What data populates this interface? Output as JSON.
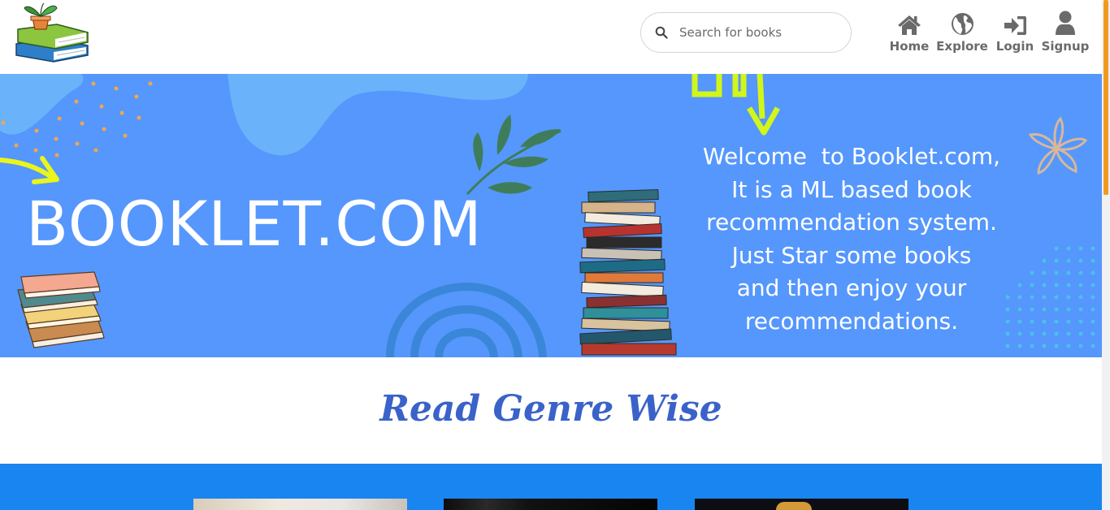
{
  "header": {
    "search": {
      "placeholder": "Search for books"
    },
    "nav": [
      {
        "label": "Home",
        "icon": "home-icon"
      },
      {
        "label": "Explore",
        "icon": "globe-icon"
      },
      {
        "label": "Login",
        "icon": "sign-in-icon"
      },
      {
        "label": "Signup",
        "icon": "user-icon"
      }
    ]
  },
  "banner": {
    "brand": "BOOKLET.COM",
    "welcome_lines": [
      "Welcome  to Booklet.com,",
      "It is a ML based book",
      "recommendation system.",
      "Just Star some books",
      "and then enjoy your",
      "recommendations."
    ]
  },
  "genres": {
    "title": "Read Genre Wise"
  },
  "colors": {
    "banner_bg": "#5597fc",
    "genre_strip": "#1985f0",
    "heading": "#3a62c9",
    "nav_text": "#6a6a6a",
    "scroll_thumb": "#f29a1e"
  }
}
